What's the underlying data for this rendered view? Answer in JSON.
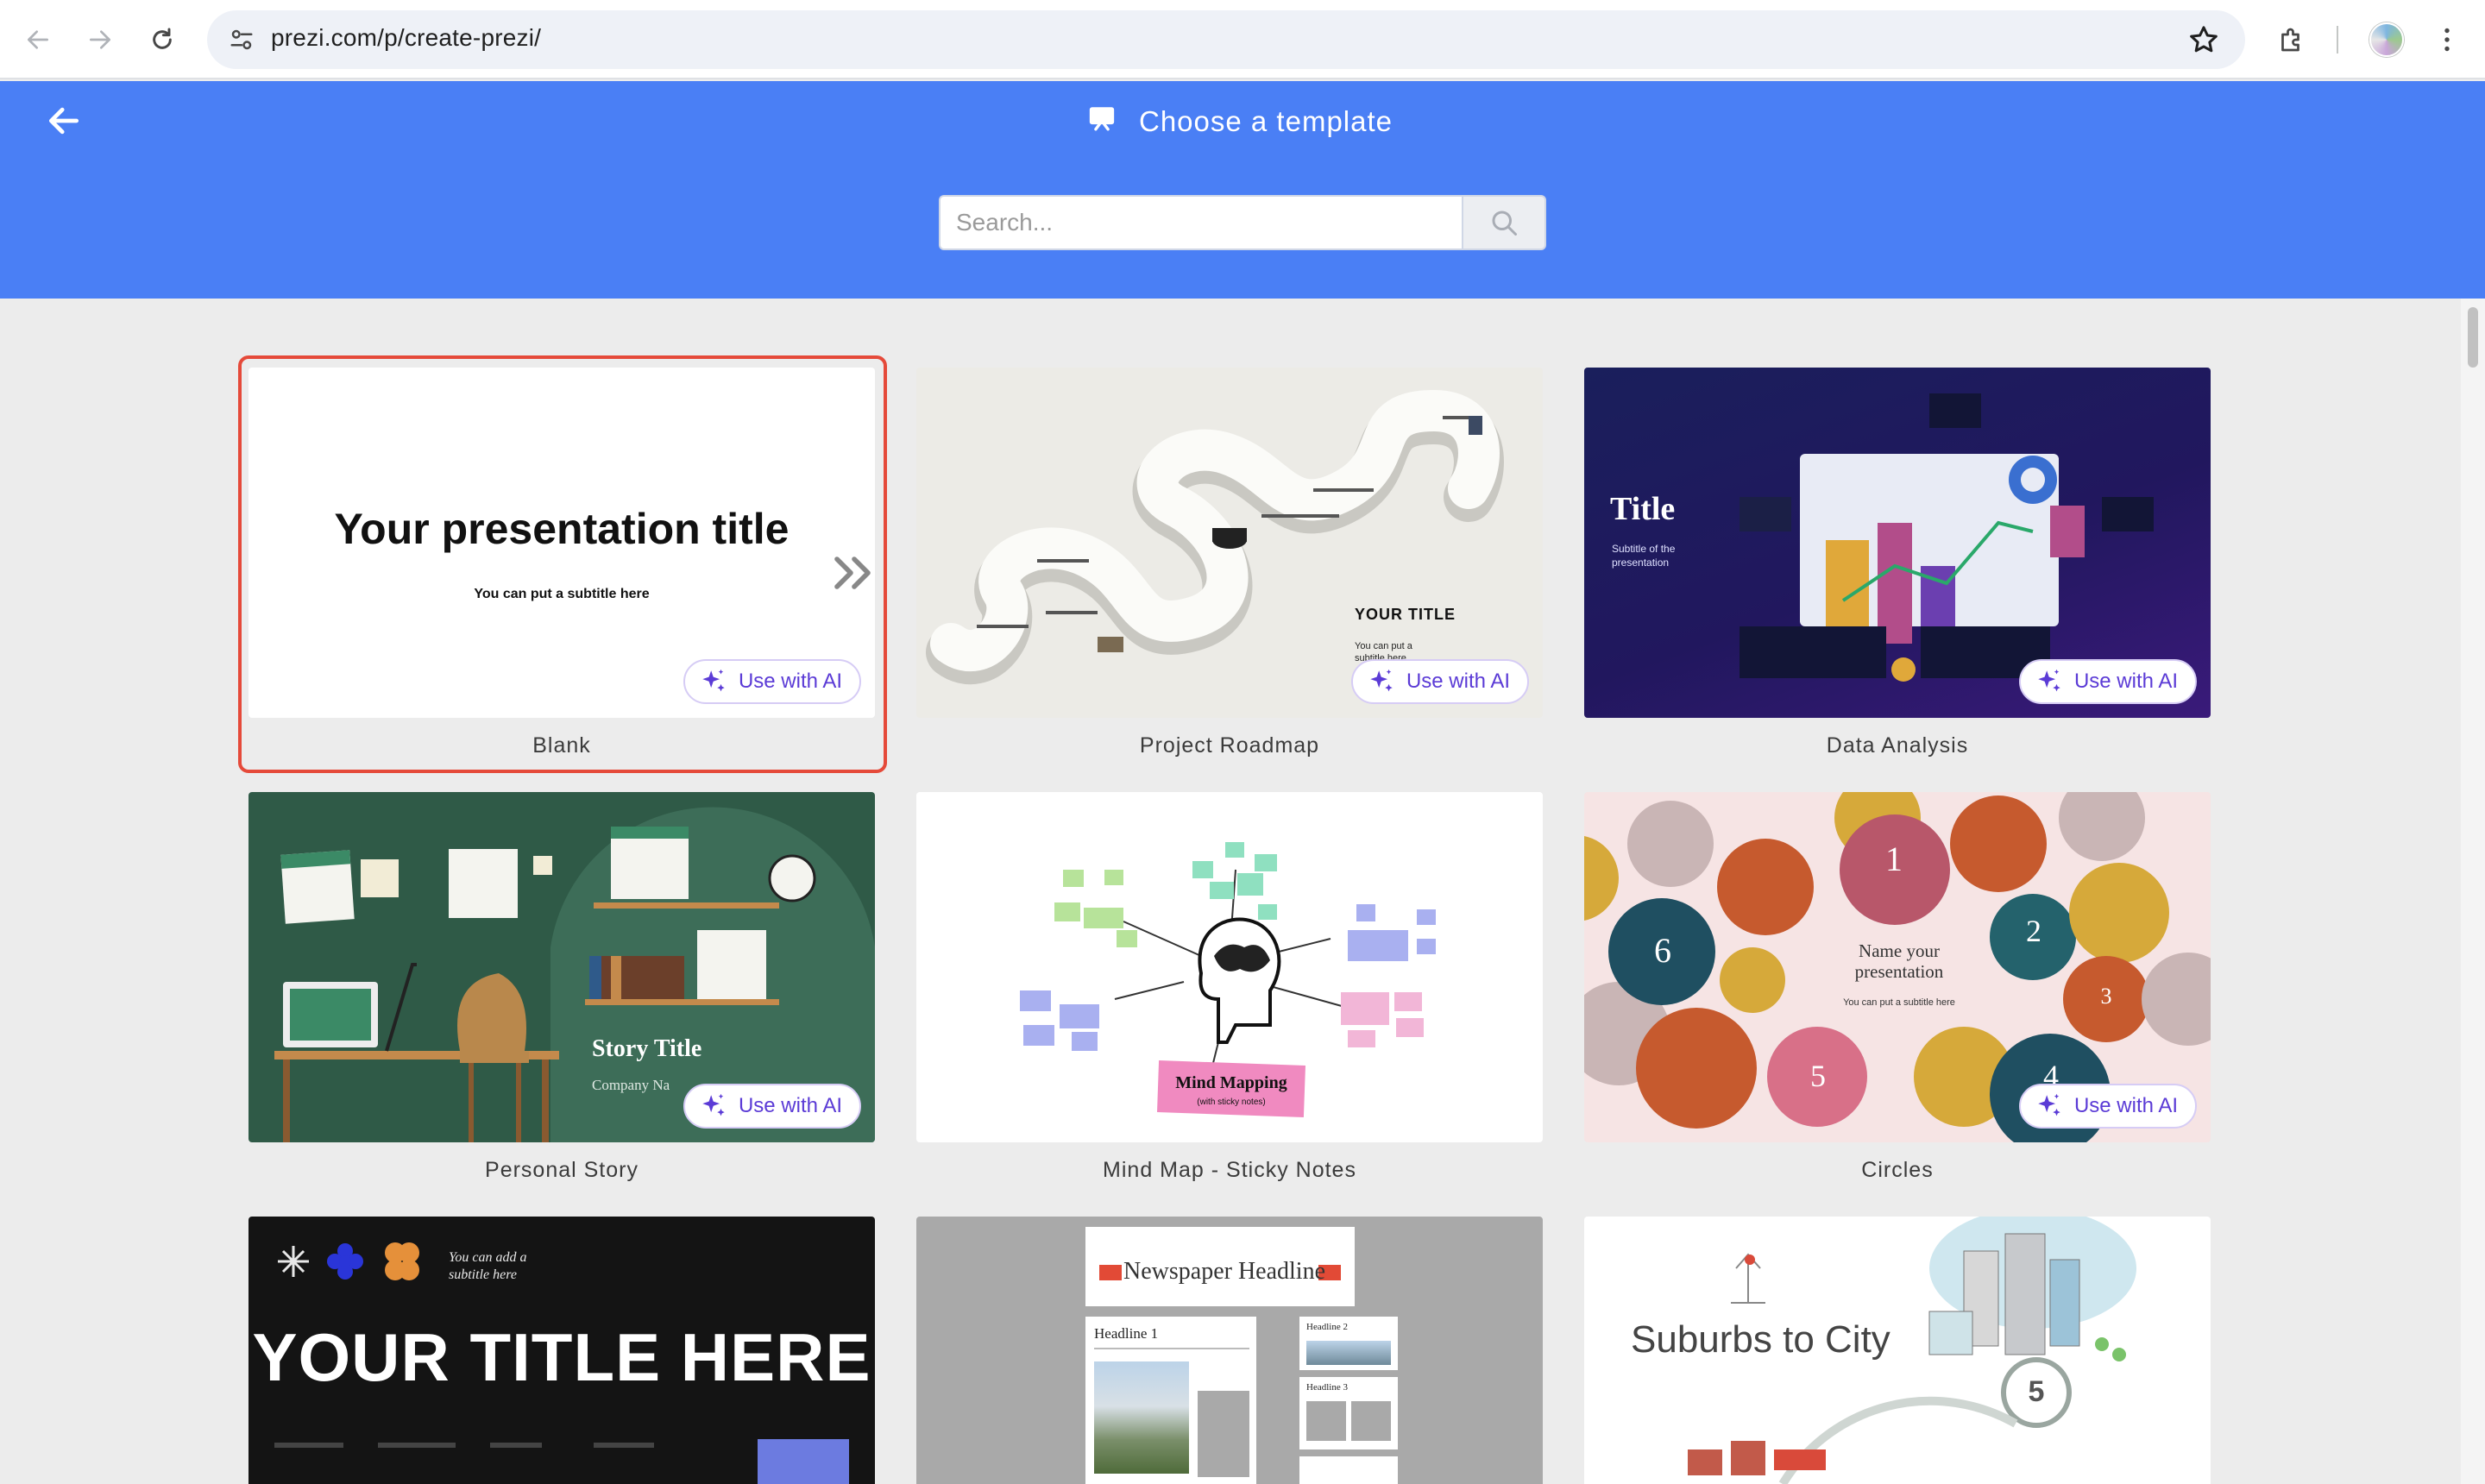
{
  "browser": {
    "url": "prezi.com/p/create-prezi/"
  },
  "header": {
    "title": "Choose a template",
    "search_placeholder": "Search..."
  },
  "ai_label": "Use with AI",
  "templates": [
    {
      "label": "Blank",
      "title": "Your presentation title",
      "subtitle": "You can put a subtitle here"
    },
    {
      "label": "Project Roadmap",
      "title": "YOUR TITLE",
      "subtitle": "You can put a subtitle here"
    },
    {
      "label": "Data Analysis",
      "title": "Title",
      "subtitle": "Subtitle of the presentation"
    },
    {
      "label": "Personal Story",
      "title": "Story Title",
      "subtitle": "Company Na"
    },
    {
      "label": "Mind Map - Sticky Notes",
      "title": "Mind Mapping",
      "subtitle": "(with sticky notes)"
    },
    {
      "label": "Circles",
      "title": "Name your presentation",
      "subtitle": "You can put a subtitle here",
      "numbers": [
        "1",
        "2",
        "3",
        "4",
        "5",
        "6"
      ]
    },
    {
      "title": "YOUR TITLE HERE",
      "subtitle": "You can add a subtitle here"
    },
    {
      "title": "Newspaper Headline",
      "headline1": "Headline 1",
      "headline2": "Headline 2",
      "headline3": "Headline 3"
    },
    {
      "title": "Suburbs to City",
      "number": "5"
    }
  ]
}
